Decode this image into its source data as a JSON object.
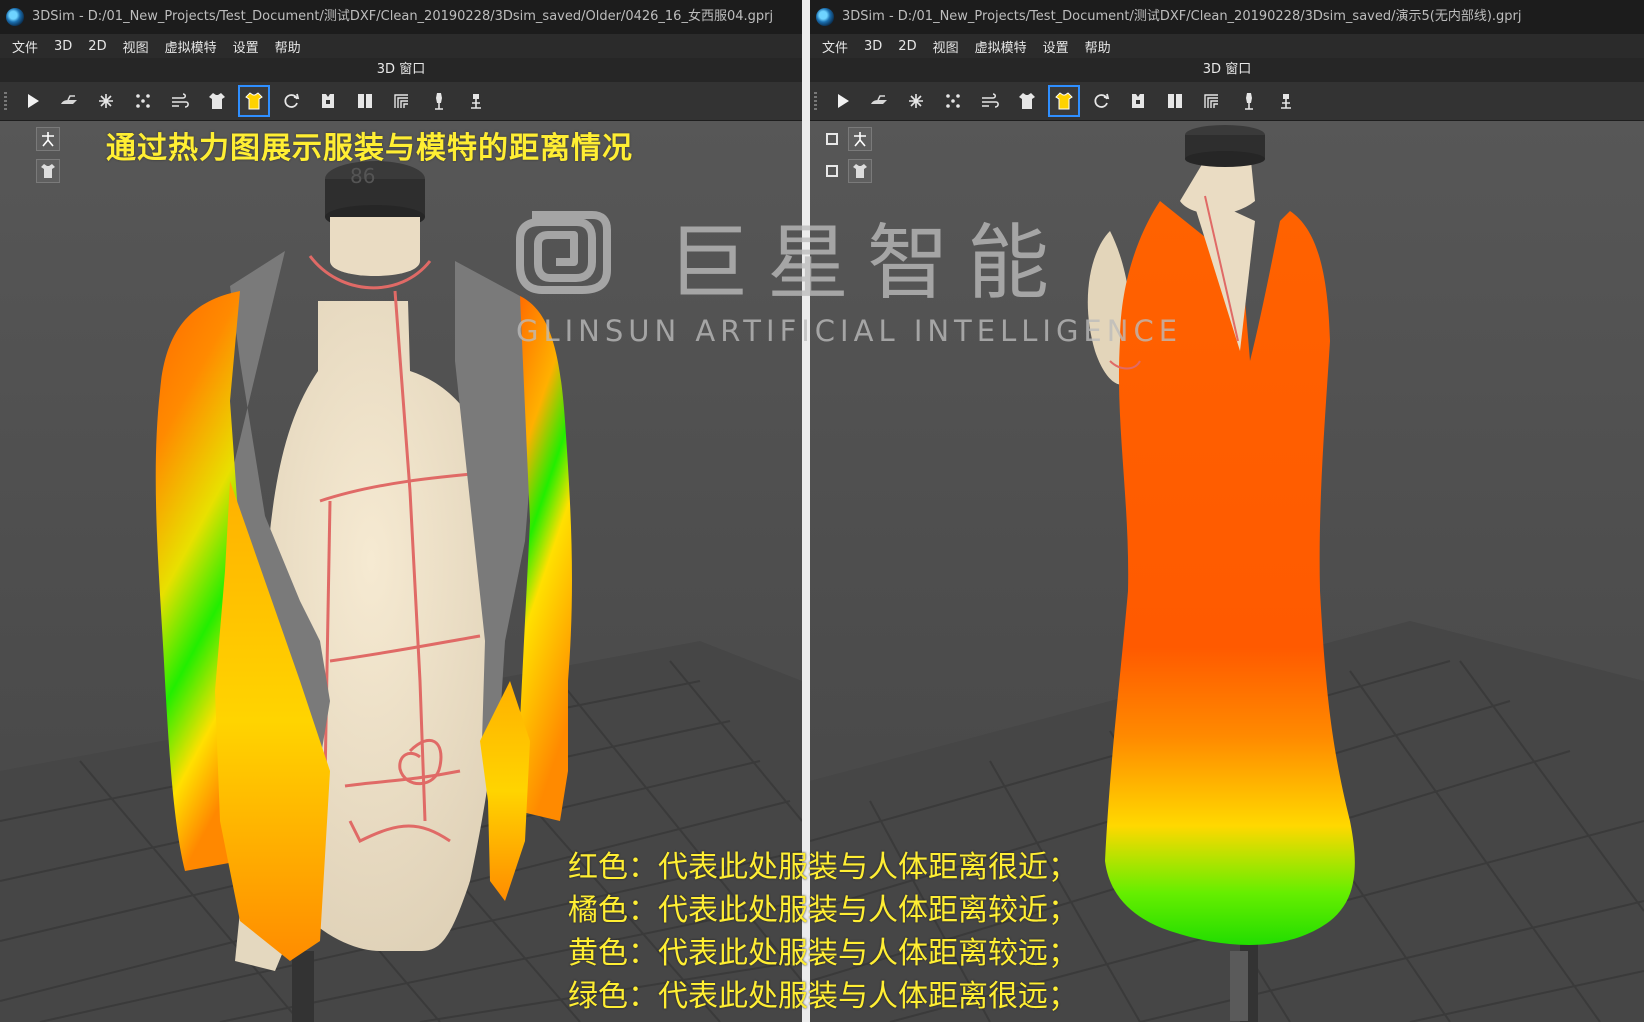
{
  "windows": {
    "left": {
      "title": "3DSim - D:/01_New_Projects/Test_Document/测试DXF/Clean_20190228/3Dsim_saved/Older/0426_16_女西服04.gprj",
      "panel_title": "3D 窗口"
    },
    "right": {
      "title": "3DSim - D:/01_New_Projects/Test_Document/测试DXF/Clean_20190228/3Dsim_saved/演示5(无内部线).gprj",
      "panel_title": "3D 窗口"
    }
  },
  "menu": [
    "文件",
    "3D",
    "2D",
    "视图",
    "虚拟模特",
    "设置",
    "帮助"
  ],
  "toolbar": {
    "icons": [
      "play-icon",
      "iron-icon",
      "pin-icon",
      "points-icon",
      "wind-icon",
      "shirt-icon",
      "heatmap-shirt-icon",
      "refresh-icon",
      "garment-front-icon",
      "garment-split-icon",
      "fabric-grain-icon",
      "stand-icon",
      "stand-reset-icon"
    ],
    "active_index": 6,
    "accent_color": "#2f8fff"
  },
  "overlay": {
    "title": "通过热力图展示服装与模特的距离情况",
    "watermark_cn": "巨星智能",
    "watermark_en": "GLINSUN  ARTIFICIAL INTELLIGENCE",
    "legend": [
      "红色：代表此处服装与人体距离很近；",
      "橘色：代表此处服装与人体距离较近；",
      "黄色：代表此处服装与人体距离较远；",
      "绿色：代表此处服装与人体距离很远；"
    ],
    "mannequin_size_mark": "86"
  },
  "colors": {
    "near": "#ff3a00",
    "close": "#ff6a00",
    "far": "#ffe000",
    "very_far": "#22ee00",
    "overlay_text": "#ffee33"
  }
}
